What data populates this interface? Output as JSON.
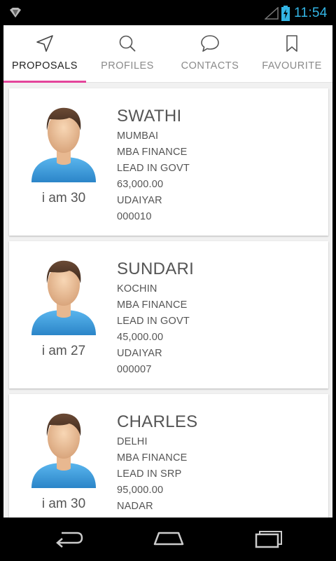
{
  "status_bar": {
    "time": "11:54",
    "icons": [
      "notification-icon",
      "signal-icon",
      "battery-icon"
    ]
  },
  "tabs": [
    {
      "label": "PROPOSALS",
      "icon": "send-icon",
      "active": true
    },
    {
      "label": "PROFILES",
      "icon": "search-icon",
      "active": false
    },
    {
      "label": "CONTACTS",
      "icon": "chat-icon",
      "active": false
    },
    {
      "label": "FAVOURITE",
      "icon": "bookmark-icon",
      "active": false
    }
  ],
  "accent_color": "#e4459b",
  "status_color": "#33b5e5",
  "profiles": [
    {
      "name": "SWATHI",
      "age": "i am 30",
      "city": "MUMBAI",
      "education": "MBA FINANCE",
      "job": "LEAD IN GOVT",
      "income": "63,000.00",
      "caste": "UDAIYAR",
      "id": "000010"
    },
    {
      "name": "SUNDARI",
      "age": "i am 27",
      "city": "KOCHIN",
      "education": "MBA FINANCE",
      "job": "LEAD IN GOVT",
      "income": "45,000.00",
      "caste": "UDAIYAR",
      "id": "000007"
    },
    {
      "name": "CHARLES",
      "age": "i am 30",
      "city": "DELHI",
      "education": "MBA FINANCE",
      "job": "LEAD IN SRP",
      "income": "95,000.00",
      "caste": "NADAR",
      "id": ""
    }
  ],
  "nav_bar": [
    "back-icon",
    "home-icon",
    "recent-apps-icon"
  ]
}
